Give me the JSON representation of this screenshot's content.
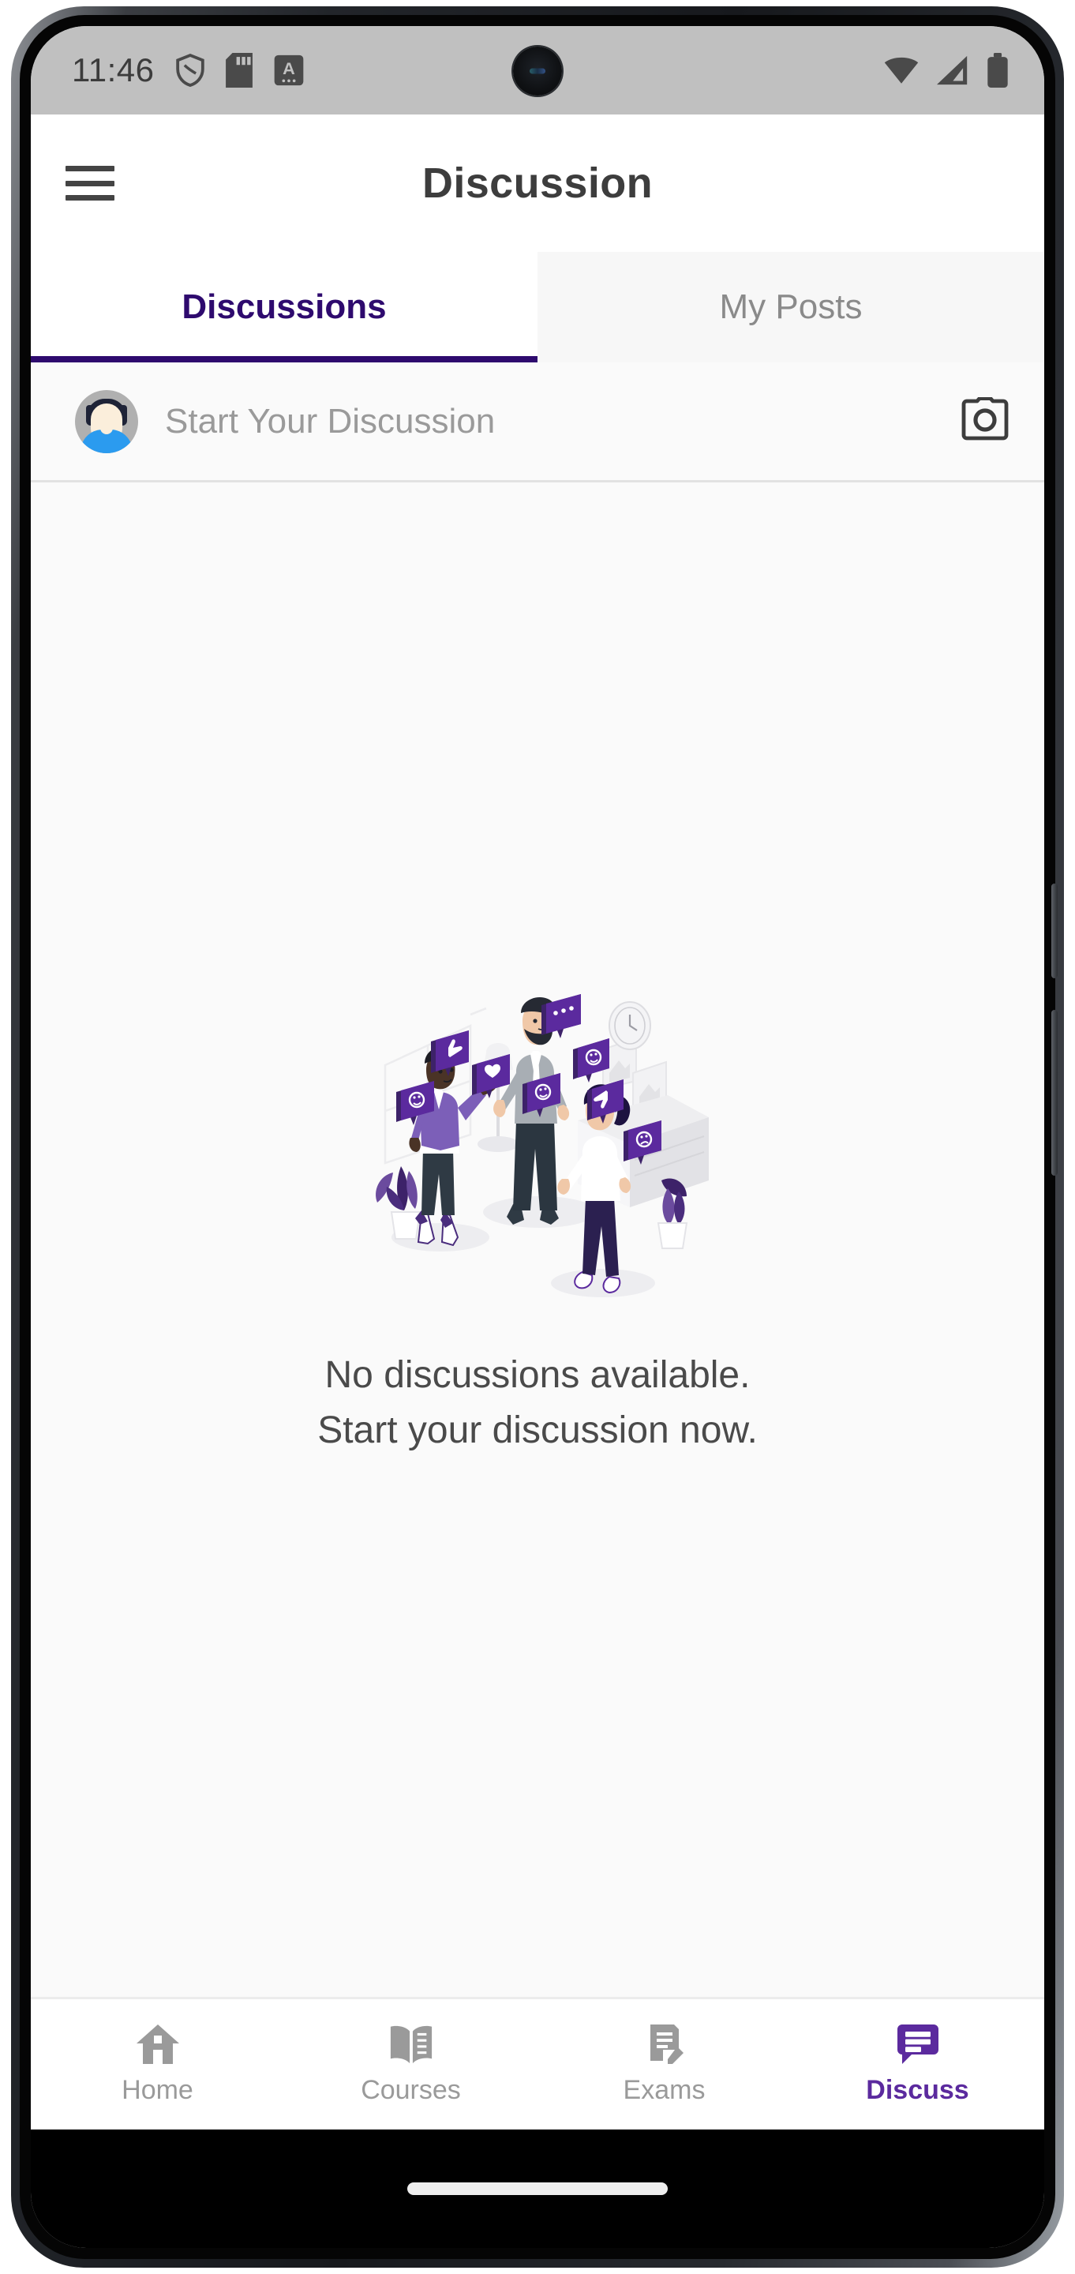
{
  "status_bar": {
    "time": "11:46",
    "left_icons": [
      "shield-vpn-icon",
      "sd-card-icon",
      "keyboard-a-icon"
    ],
    "right_icons": [
      "wifi-icon",
      "cellular-signal-icon",
      "battery-icon"
    ]
  },
  "header": {
    "title": "Discussion",
    "menu_icon": "hamburger-menu-icon"
  },
  "tabs": [
    {
      "label": "Discussions",
      "active": true
    },
    {
      "label": "My Posts",
      "active": false
    }
  ],
  "composer": {
    "placeholder": "Start Your Discussion",
    "avatar": "user-avatar",
    "camera_icon": "camera-icon"
  },
  "empty_state": {
    "illustration": "people-discussing-illustration",
    "line1": "No discussions available.",
    "line2": "Start your discussion now."
  },
  "bottom_nav": [
    {
      "label": "Home",
      "icon": "home-icon",
      "active": false
    },
    {
      "label": "Courses",
      "icon": "book-icon",
      "active": false
    },
    {
      "label": "Exams",
      "icon": "exam-icon",
      "active": false
    },
    {
      "label": "Discuss",
      "icon": "chat-icon",
      "active": true
    }
  ],
  "colors": {
    "accent_purple": "#2e0a6e",
    "nav_active_purple": "#5b2a9e",
    "status_bar_bg": "#c0c0c0",
    "content_bg": "#fafafa",
    "inactive_gray": "#9a9a9a"
  }
}
